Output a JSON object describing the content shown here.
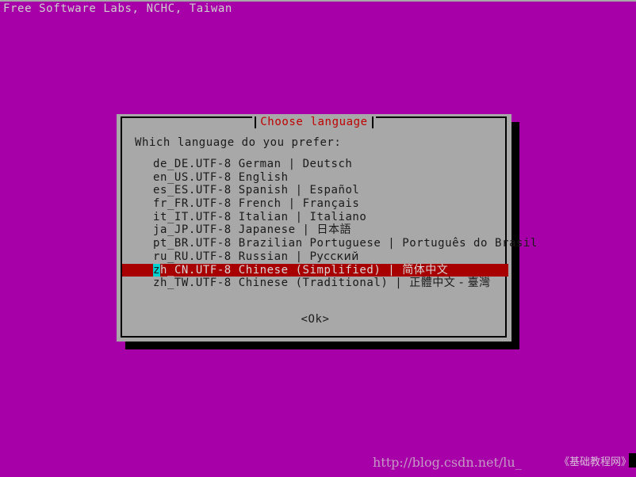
{
  "screen": {
    "background_color": "#a800a8",
    "banner_text": "Free Software Labs, NCHC, Taiwan"
  },
  "dialog": {
    "title": "Choose language",
    "title_color": "#c00000",
    "background_color": "#a8a8a8",
    "prompt": "Which language do you prefer:",
    "ok_label": "<Ok>",
    "selection_highlight_color": "#a80000",
    "cursor_highlight_color": "#00d0d0",
    "languages": [
      {
        "locale": "de_DE.UTF-8",
        "english": "German",
        "sep": "|",
        "native": "Deutsch",
        "selected": false
      },
      {
        "locale": "en_US.UTF-8",
        "english": "English",
        "sep": "",
        "native": "",
        "selected": false
      },
      {
        "locale": "es_ES.UTF-8",
        "english": "Spanish",
        "sep": "|",
        "native": "Español",
        "selected": false
      },
      {
        "locale": "fr_FR.UTF-8",
        "english": "French",
        "sep": "|",
        "native": "Français",
        "selected": false
      },
      {
        "locale": "it_IT.UTF-8",
        "english": "Italian",
        "sep": "|",
        "native": "Italiano",
        "selected": false
      },
      {
        "locale": "ja_JP.UTF-8",
        "english": "Japanese",
        "sep": "|",
        "native": "日本語",
        "selected": false
      },
      {
        "locale": "pt_BR.UTF-8",
        "english": "Brazilian Portuguese",
        "sep": "|",
        "native": "Português do Brasil",
        "selected": false
      },
      {
        "locale": "ru_RU.UTF-8",
        "english": "Russian",
        "sep": "|",
        "native": "Русский",
        "selected": false
      },
      {
        "locale": "zh_CN.UTF-8",
        "english": "Chinese (Simplified)",
        "sep": "|",
        "native": "简体中文",
        "selected": true
      },
      {
        "locale": "zh_TW.UTF-8",
        "english": "Chinese (Traditional)",
        "sep": "|",
        "native": "正體中文 - 臺灣",
        "selected": false
      }
    ]
  },
  "watermark": {
    "url": "http://blog.csdn.net/lu_",
    "chinese": "《基础教程网》"
  }
}
